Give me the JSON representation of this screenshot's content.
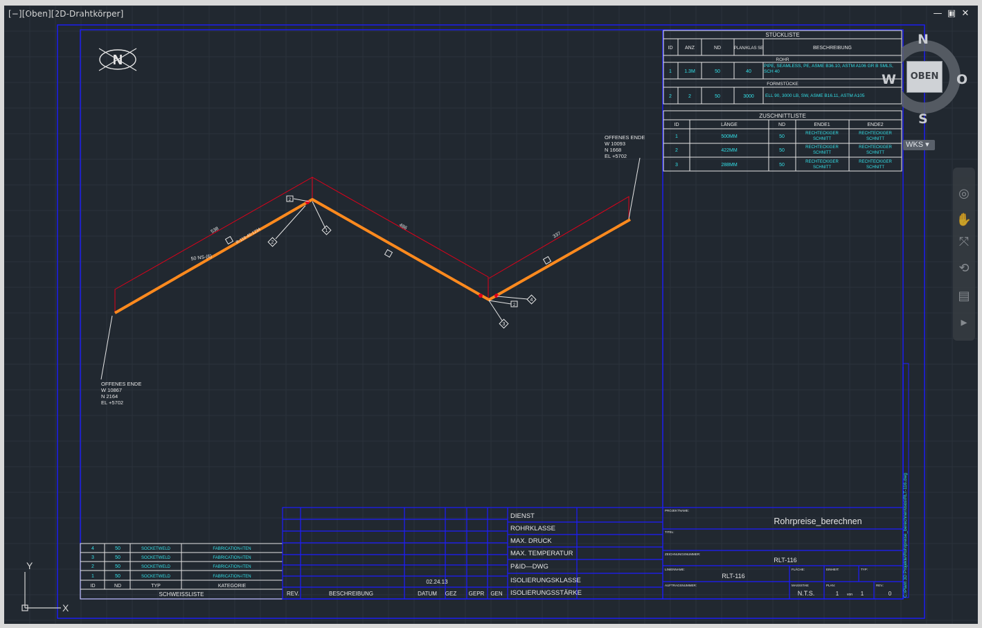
{
  "viewport": {
    "label": "[−][Oben][2D-Drahtkörper]",
    "window_buttons": [
      "—",
      "▣",
      "✕"
    ]
  },
  "viewcube": {
    "top_label": "OBEN",
    "north": "N",
    "south": "S",
    "west": "W",
    "east": "O",
    "wcs_label": "WKS ▾"
  },
  "navbar": {
    "icons": [
      "steering-wheel-icon",
      "pan-icon",
      "zoom-icon",
      "orbit-icon",
      "showmotion-icon",
      "navigation-menu-icon"
    ]
  },
  "ucs": {
    "y_label": "Y",
    "x_label": "X"
  },
  "drawing": {
    "north_symbol": "N",
    "open_end_left": [
      "OFFENES ENDE",
      "W 10867",
      "N 2164",
      "EL +5702"
    ],
    "open_end_right": [
      "OFFENES ENDE",
      "W 10093",
      "N 1668",
      "EL +5702"
    ],
    "dim_1": "538",
    "dim_2": "486",
    "dim_3": "337",
    "pipe_label": "50 NS-(6)",
    "pipe_tag": "R-116-40-1234",
    "weld_tag": "2",
    "bubble_1": "1",
    "bubble_2": "2",
    "bubble_3": "3",
    "bubble_4": "4",
    "weld_tag2": "2"
  },
  "stueckliste": {
    "title": "STÜCKLISTE",
    "headers": [
      "ID",
      "ANZ",
      "ND",
      "PLAN/KLAS SE",
      "BESCHREIBUNG"
    ],
    "group_rohr": "ROHR",
    "group_formstuecke": "FORMSTÜCKE",
    "rows": [
      [
        "1",
        "1.3M",
        "50",
        "40",
        "PIPE, SEAMLESS, PE, ASME B36.10, ASTM A106 GR B SMLS, SCH 40"
      ],
      [
        "2",
        "2",
        "50",
        "3000",
        "ELL 90, 3000 LB, SW, ASME B16.11, ASTM A105"
      ]
    ]
  },
  "zuschnittliste": {
    "title": "ZUSCHNITTLISTE",
    "headers": [
      "ID",
      "LÄNGE",
      "ND",
      "ENDE1",
      "ENDE2"
    ],
    "rows": [
      [
        "1",
        "500MM",
        "50",
        "RECHTECKIGER SCHNITT",
        "RECHTECKIGER SCHNITT"
      ],
      [
        "2",
        "422MM",
        "50",
        "RECHTECKIGER SCHNITT",
        "RECHTECKIGER SCHNITT"
      ],
      [
        "3",
        "288MM",
        "50",
        "RECHTECKIGER SCHNITT",
        "RECHTECKIGER SCHNITT"
      ]
    ]
  },
  "schweissliste": {
    "title": "SCHWEISSLISTE",
    "headers": [
      "ID",
      "ND",
      "TYP",
      "KATEGORIE"
    ],
    "rows": [
      [
        "4",
        "50",
        "SOCKETWELD",
        "FABRICATION-ITEN"
      ],
      [
        "3",
        "50",
        "SOCKETWELD",
        "FABRICATION-ITEN"
      ],
      [
        "2",
        "50",
        "SOCKETWELD",
        "FABRICATION-ITEN"
      ],
      [
        "1",
        "50",
        "SOCKETWELD",
        "FABRICATION-ITEN"
      ]
    ]
  },
  "revision_block": {
    "headers": [
      "REV.",
      "BESCHREIBUNG",
      "DATUM",
      "GEZ",
      "GEPR",
      "GEN"
    ],
    "date": "02.24.13",
    "fields": [
      "DIENST",
      "ROHRKLASSE",
      "MAX. DRUCK",
      "MAX. TEMPERATUR",
      "P&ID—DWG",
      "ISOLIERUNGSKLASSE",
      "ISOLIERUNGSSTÄRKE"
    ]
  },
  "title_block": {
    "projektname_label": "PROJEKTNAME:",
    "projektname": "Rohrpreise_berechnen",
    "titel_label": "TITEL:",
    "zeichnungsnummer_label": "ZEICHNUNGSNUMMER:",
    "zeichnungsnummer": "RLT-116",
    "linienname_label": "LINIENNAME:",
    "linienname": "RLT-116",
    "flaeche_label": "FLÄCHE:",
    "einheit_label": "EINHEIT:",
    "typ_label": "TYP:",
    "auftragsnummer_label": "AUFTRAGSNUMMER:",
    "massstab_label": "MASSSTAB:",
    "massstab": "N.T.S.",
    "plan_label": "PLAN:",
    "plan": "1",
    "von": "von",
    "plan_total": "1",
    "rev_label": "REV.:",
    "rev": "0",
    "side_path": "C:\\Plant 3D Projekte\\Rohrpreise_berechnen\\Isos\\RLT-116.dwg"
  },
  "colors": {
    "background": "#212830",
    "border": "#1c1cff",
    "pipe": "#ff8a1e",
    "dimension": "#e0001a",
    "text": "#e6e6e6",
    "cyan": "#33e0e8"
  }
}
